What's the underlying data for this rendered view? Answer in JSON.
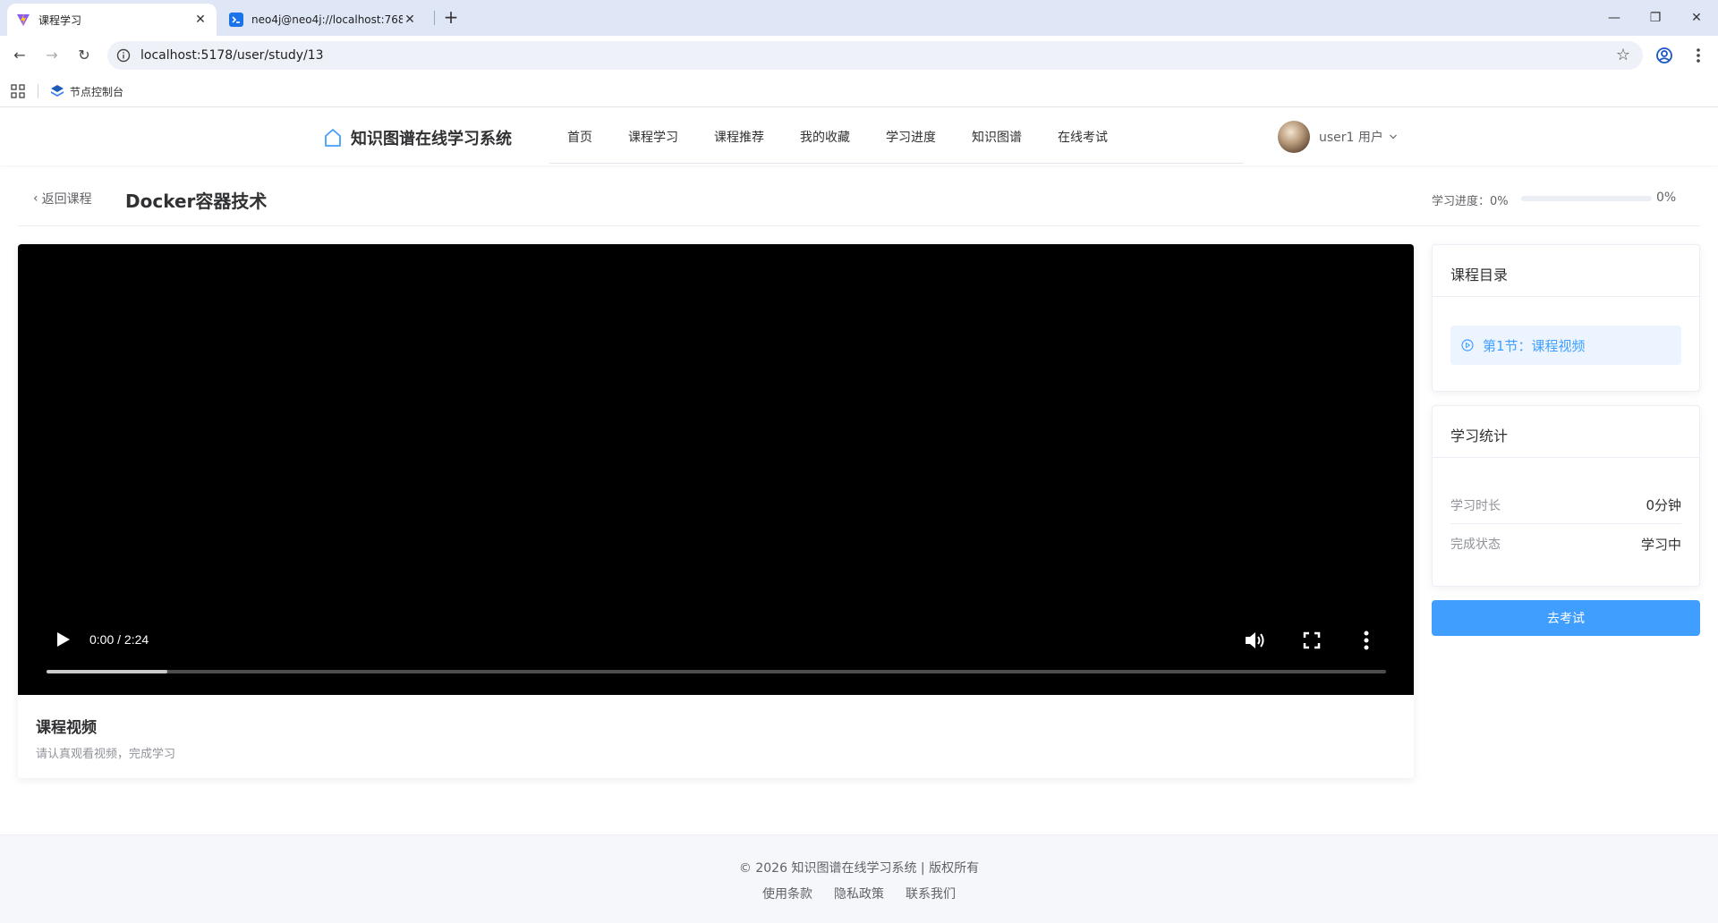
{
  "browser": {
    "tabs": [
      {
        "title": "课程学习",
        "active": true
      },
      {
        "title": "neo4j@neo4j://localhost:768",
        "active": false
      }
    ],
    "url": "localhost:5178/user/study/13",
    "bookmarks": [
      {
        "label": "节点控制台"
      }
    ]
  },
  "header": {
    "brand": "知识图谱在线学习系统",
    "nav": [
      "首页",
      "课程学习",
      "课程推荐",
      "我的收藏",
      "学习进度",
      "知识图谱",
      "在线考试"
    ],
    "user": "user1 用户"
  },
  "study": {
    "back_label": "返回课程",
    "course_title": "Docker容器技术",
    "progress_label": "学习进度：0%",
    "progress_value": "0%",
    "progress_fraction": 0
  },
  "video": {
    "time": "0:00 / 2:24",
    "buffered_fraction": 0.09,
    "title": "课程视频",
    "description": "请认真观看视频，完成学习"
  },
  "toc": {
    "title": "课程目录",
    "chapters": [
      {
        "label": "第1节：课程视频",
        "active": true
      }
    ]
  },
  "stats": {
    "title": "学习统计",
    "rows": [
      {
        "label": "学习时长",
        "value": "0分钟"
      },
      {
        "label": "完成状态",
        "value": "学习中"
      }
    ]
  },
  "exam_button": "去考试",
  "footer": {
    "copyright": "© 2026 知识图谱在线学习系统 | 版权所有",
    "links": [
      "使用条款",
      "隐私政策",
      "联系我们"
    ]
  },
  "colors": {
    "primary": "#409eff",
    "primary_light": "#ecf5ff",
    "text": "#303133",
    "muted": "#909399"
  },
  "icons": [
    "vite-logo-icon",
    "terminal-icon",
    "close-icon",
    "plus-icon",
    "minimize-icon",
    "restore-icon",
    "back-arrow-icon",
    "forward-arrow-icon",
    "reload-icon",
    "info-icon",
    "star-icon",
    "profile-icon",
    "kebab-menu-icon",
    "apps-grid-icon",
    "layers-icon",
    "home-icon",
    "chevron-down-icon",
    "chevron-left-icon",
    "play-icon",
    "volume-icon",
    "fullscreen-icon",
    "play-circle-icon"
  ]
}
